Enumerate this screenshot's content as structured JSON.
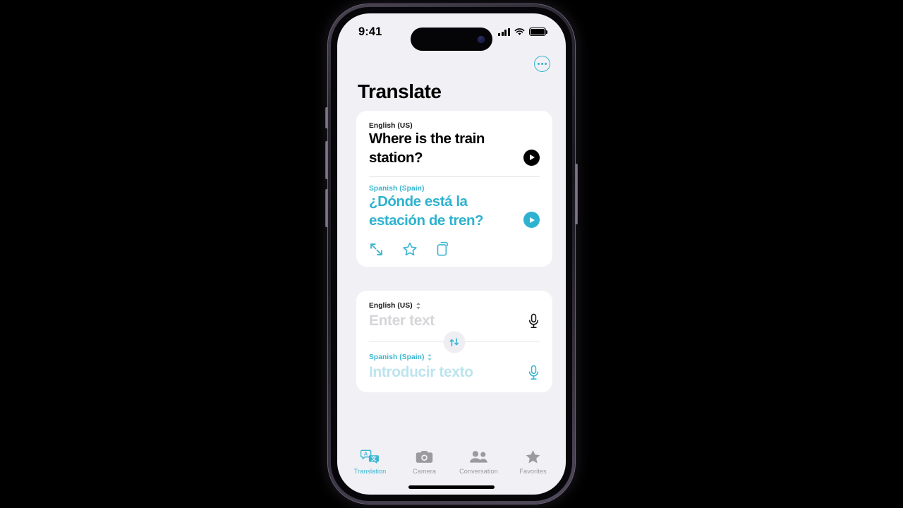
{
  "status_bar": {
    "time": "9:41",
    "signal_icon": "cellular-bars-icon",
    "wifi_icon": "wifi-icon",
    "battery_icon": "battery-full-icon"
  },
  "header": {
    "title": "Translate",
    "more_button_icon": "ellipsis-circle-icon"
  },
  "result_card": {
    "source": {
      "language": "English (US)",
      "text": "Where is the train station?",
      "play_icon": "play-circle-icon"
    },
    "target": {
      "language": "Spanish (Spain)",
      "text": "¿Dónde está la estación de tren?",
      "play_icon": "play-circle-icon"
    },
    "actions": [
      {
        "name": "expand-icon",
        "label": "Expand"
      },
      {
        "name": "star-icon",
        "label": "Favorite"
      },
      {
        "name": "copy-icon",
        "label": "Copy"
      }
    ]
  },
  "input_card": {
    "source": {
      "language": "English (US)",
      "placeholder": "Enter text",
      "value": "",
      "chevron_icon": "chevron-up-down-icon",
      "mic_icon": "microphone-icon"
    },
    "swap_button": {
      "icon": "swap-arrows-icon",
      "label": "Swap languages"
    },
    "target": {
      "language": "Spanish (Spain)",
      "placeholder": "Introducir texto",
      "value": "",
      "chevron_icon": "chevron-up-down-icon",
      "mic_icon": "microphone-icon"
    }
  },
  "tab_bar": {
    "items": [
      {
        "label": "Translation",
        "icon": "translate-bubbles-icon",
        "active": true
      },
      {
        "label": "Camera",
        "icon": "camera-icon",
        "active": false
      },
      {
        "label": "Conversation",
        "icon": "two-people-icon",
        "active": false
      },
      {
        "label": "Favorites",
        "icon": "star-filled-icon",
        "active": false
      }
    ]
  },
  "colors": {
    "accent_cyan": "#2EB2CF",
    "accent_cyan_light": "#37B5D1",
    "placeholder_gray": "#D6D6DA",
    "placeholder_cyan": "#BDE4EE",
    "screen_background": "#F1F1F5",
    "card_background": "#FFFFFF",
    "text_primary": "#000000",
    "tab_inactive": "#9A9AA0"
  }
}
